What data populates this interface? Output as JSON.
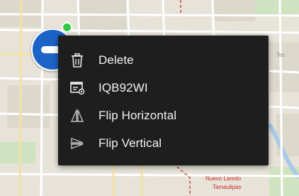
{
  "map": {
    "labels": [
      "Nuevo Laredo",
      "Tamaulipas"
    ]
  },
  "context_menu": {
    "items": [
      {
        "label": "Delete",
        "icon": "trash-icon"
      },
      {
        "label": "IQB92WI",
        "icon": "asset-id-icon"
      },
      {
        "label": "Flip Horizontal",
        "icon": "flip-horizontal-icon"
      },
      {
        "label": "Flip Vertical",
        "icon": "flip-vertical-icon"
      }
    ]
  },
  "colors": {
    "menu_background": "#1e1e1e",
    "menu_text": "#f2f2f2",
    "marker_blue": "#1b63c6",
    "status_green": "#2ecc40",
    "city_label_red": "#cc2a2a"
  }
}
